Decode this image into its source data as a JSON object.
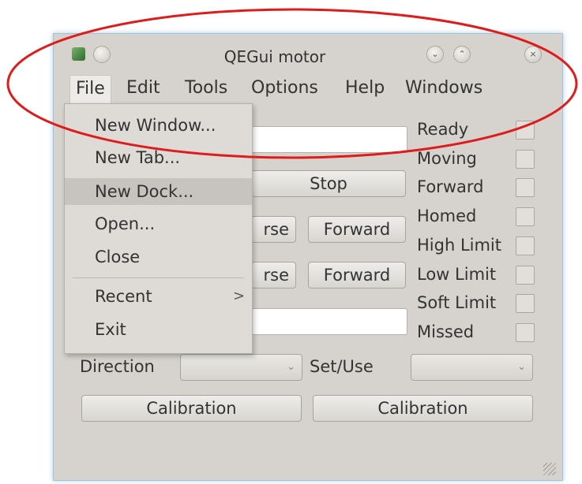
{
  "window": {
    "title": "QEGui motor",
    "controls": {
      "minimize": "minimize-icon",
      "maximize": "maximize-icon",
      "close": "close-icon"
    }
  },
  "menubar": [
    "File",
    "Edit",
    "Tools",
    "Options",
    "Help",
    "Windows"
  ],
  "file_menu": {
    "items": [
      "New Window...",
      "New Tab...",
      "New Dock...",
      "Open...",
      "Close",
      "Recent",
      "Exit"
    ],
    "highlighted": "New Dock...",
    "recent_arrow": ">"
  },
  "panel": {
    "stop_button": "Stop",
    "reverse_fragment_1": "rse",
    "forward_button_1": "Forward",
    "reverse_fragment_2": "rse",
    "forward_button_2": "Forward",
    "direction_label": "Direction",
    "setuse_label": "Set/Use",
    "calibration_button_1": "Calibration",
    "calibration_button_2": "Calibration",
    "status_labels": [
      "Ready",
      "Moving",
      "Forward",
      "Homed",
      "High Limit",
      "Low Limit",
      "Soft Limit",
      "Missed"
    ]
  },
  "annotation": {
    "color": "#e01b1b"
  }
}
